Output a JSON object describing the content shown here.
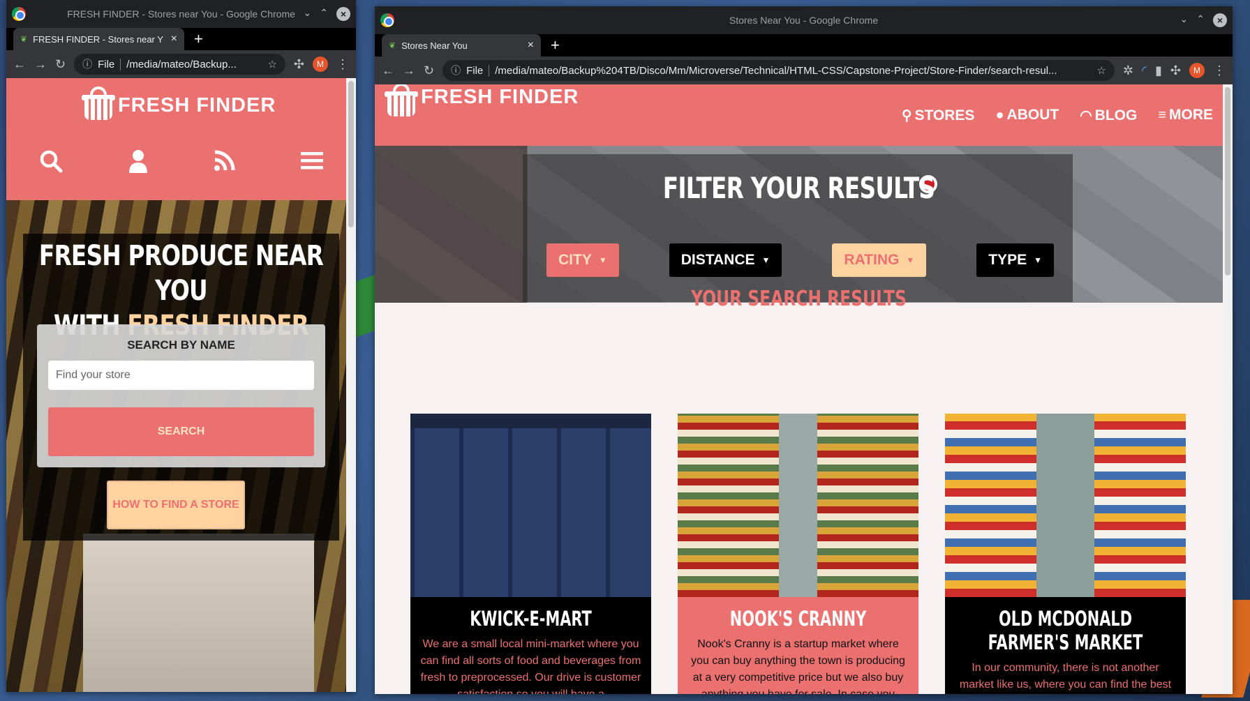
{
  "left_window": {
    "title": "FRESH FINDER - Stores near You - Google Chrome",
    "tab_label": "FRESH FINDER - Stores near Y",
    "omnibox": {
      "scheme": "File",
      "url": "/media/mateo/Backup..."
    },
    "avatar": "M",
    "page": {
      "brand": "FRESH FINDER",
      "hero_line1": "FRESH PRODUCE NEAR YOU",
      "hero_line2_prefix": "WITH ",
      "hero_line2_highlight": "FRESH FINDER",
      "search_label": "SEARCH BY NAME",
      "search_placeholder": "Find your store",
      "search_button": "SEARCH",
      "howto_button": "HOW TO FIND A STORE"
    }
  },
  "right_window": {
    "title": "Stores Near You - Google Chrome",
    "tab_label": "Stores Near You",
    "omnibox": {
      "scheme": "File",
      "url": "/media/mateo/Backup%204TB/Disco/Mm/Microverse/Technical/HTML-CSS/Capstone-Project/Store-Finder/search-resul..."
    },
    "avatar": "M",
    "page": {
      "brand": "FRESH FINDER",
      "nav": [
        "STORES",
        "ABOUT",
        "BLOG",
        "MORE"
      ],
      "filter_title": "FILTER YOUR RESULTS",
      "filters": [
        "CITY",
        "DISTANCE",
        "RATING",
        "TYPE"
      ],
      "results_title": "YOUR SEARCH RESULTS",
      "stores": [
        {
          "name": "KWICK-E-MART",
          "desc": "We are a small local mini-market where you can find all sorts of food and beverages from fresh to preprocessed. Our drive is customer satisfaction so you will have a"
        },
        {
          "name": "NOOK'S CRANNY",
          "desc": "Nook's Cranny is a startup market where you can buy anything the town is producing at a very competitive price but we also buy anything you have for sale. In case you"
        },
        {
          "name": "OLD MCDONALD FARMER'S MARKET",
          "desc": "In our community, there is not another market like us, where you can find the best"
        }
      ]
    }
  },
  "colors": {
    "brand": "#eb7070",
    "accent": "#ffd2a0",
    "dark": "#000000"
  }
}
